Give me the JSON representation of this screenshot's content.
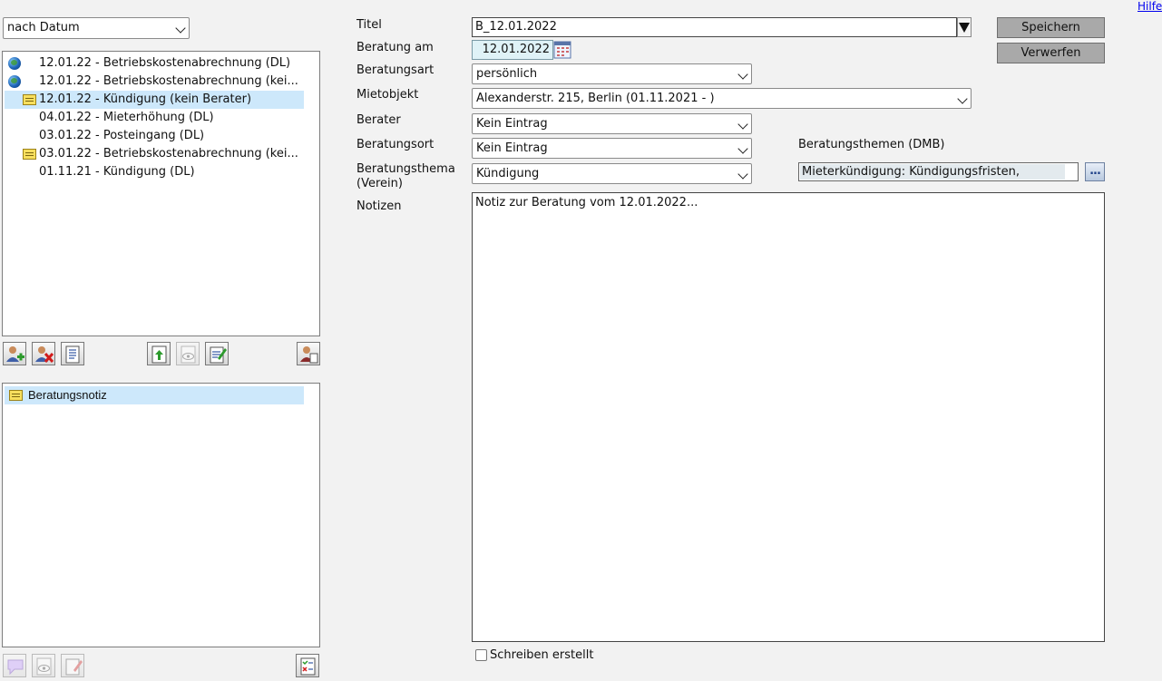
{
  "header": {
    "help_link": "Hilfe"
  },
  "sort": {
    "selected": "nach Datum"
  },
  "consultations": [
    {
      "icon": "globe-icon",
      "label": "12.01.22 - Betriebskostenabrechnung (DL)",
      "selected": false
    },
    {
      "icon": "globe-icon",
      "label": "12.01.22 - Betriebskostenabrechnung (kei...",
      "selected": false
    },
    {
      "icon": "note-pen-icon",
      "label": "12.01.22 - Kündigung (kein Berater)",
      "selected": true
    },
    {
      "icon": "",
      "label": "04.01.22 - Mieterhöhung (DL)",
      "selected": false
    },
    {
      "icon": "",
      "label": "03.01.22 - Posteingang (DL)",
      "selected": false
    },
    {
      "icon": "note-pen-icon",
      "label": "03.01.22 - Betriebskostenabrechnung (kei...",
      "selected": false
    },
    {
      "icon": "",
      "label": "01.11.21 - Kündigung (DL)",
      "selected": false
    }
  ],
  "documents": [
    {
      "icon": "note-icon",
      "label": "Beratungsnotiz",
      "selected": true
    }
  ],
  "form": {
    "titel_label": "Titel",
    "titel_value": "B_12.01.2022",
    "beratung_am_label": "Beratung am",
    "beratung_am_value": "12.01.2022",
    "beratungsart_label": "Beratungsart",
    "beratungsart_value": "persönlich",
    "mietobjekt_label": "Mietobjekt",
    "mietobjekt_value": "Alexanderstr. 215, Berlin (01.11.2021 - )",
    "berater_label": "Berater",
    "berater_value": "Kein Eintrag",
    "beratungsort_label": "Beratungsort",
    "beratungsort_value": "Kein Eintrag",
    "beratungsthema_label_1": "Beratungsthema",
    "beratungsthema_label_2": "(Verein)",
    "beratungsthema_value": "Kündigung",
    "themen_dmb_label": "Beratungsthemen (DMB)",
    "themen_dmb_value": "Mieterkündigung: Kündigungsfristen,",
    "themen_dmb_button": "...",
    "notizen_label": "Notizen",
    "notizen_value": "Notiz zur Beratung vom 12.01.2022...",
    "schreiben_label": "Schreiben erstellt",
    "schreiben_checked": false
  },
  "actions": {
    "save": "Speichern",
    "discard": "Verwerfen"
  },
  "colors": {
    "selection": "#cde8fb",
    "date_field": "#dff2f7",
    "button": "#a9a9a9"
  }
}
